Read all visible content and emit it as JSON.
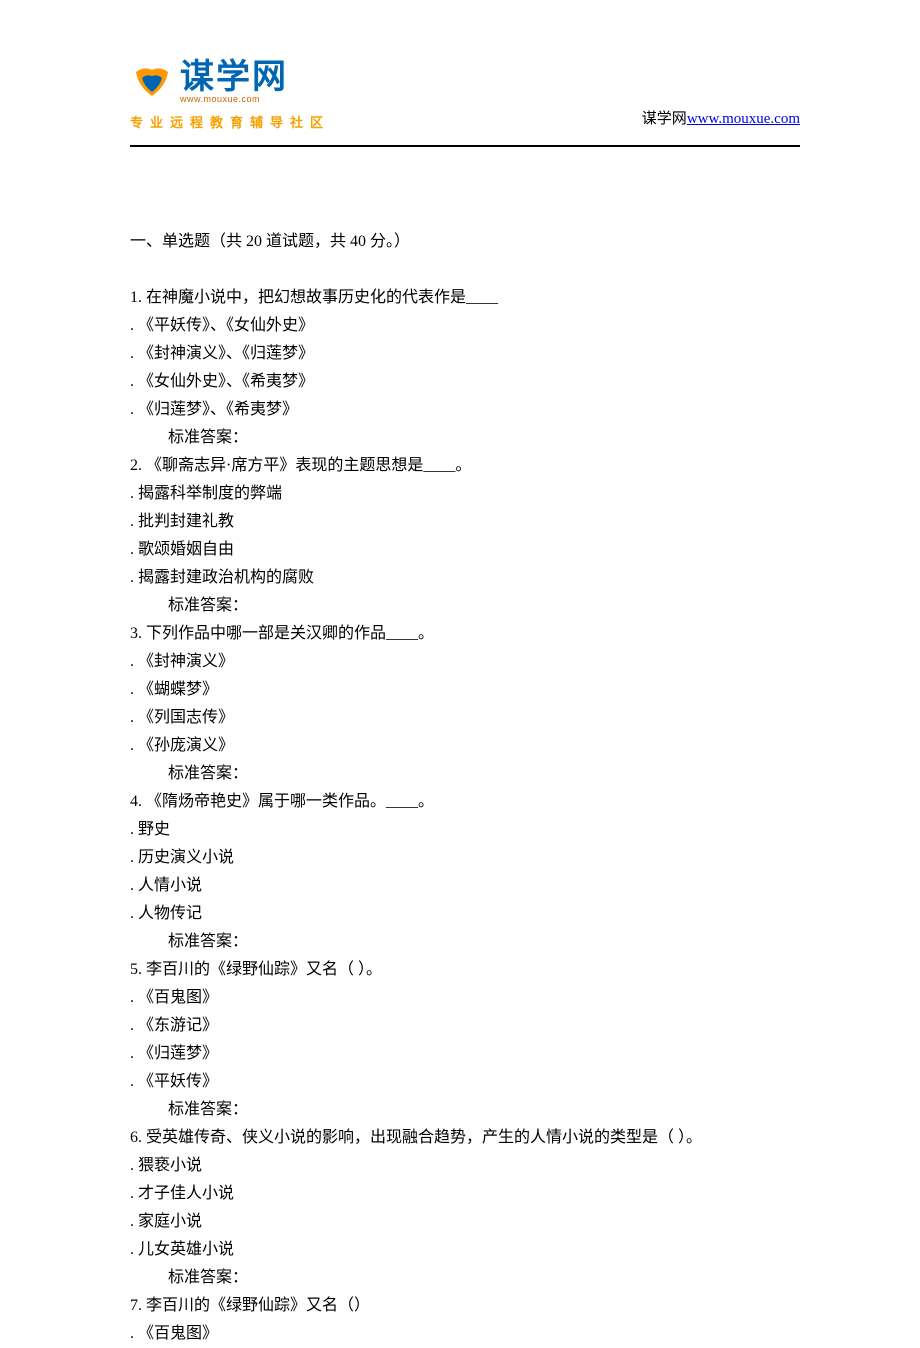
{
  "header": {
    "logo_cn": "谋学网",
    "logo_url": "www.mouxue.com",
    "logo_sub": "专业远程教育辅导社区",
    "right_label": "谋学网",
    "right_link": "www.mouxue.com"
  },
  "section_title": "一、单选题（共 20 道试题，共 40 分。）",
  "questions": [
    {
      "num": "1.",
      "text": "  在神魔小说中，把幻想故事历史化的代表作是____",
      "options": [
        ".  《平妖传》、《女仙外史》",
        ".  《封神演义》、《归莲梦》",
        ".  《女仙外史》、《希夷梦》",
        ".  《归莲梦》、《希夷梦》"
      ],
      "answer": "标准答案："
    },
    {
      "num": "2.",
      "text": "  《聊斋志异·席方平》表现的主题思想是____。",
      "options": [
        ".  揭露科举制度的弊端",
        ".  批判封建礼教",
        ".  歌颂婚姻自由",
        ".  揭露封建政治机构的腐败"
      ],
      "answer": "标准答案："
    },
    {
      "num": "3.",
      "text": "  下列作品中哪一部是关汉卿的作品____。",
      "options": [
        ".  《封神演义》",
        ".  《蝴蝶梦》",
        ".  《列国志传》",
        ".  《孙庞演义》"
      ],
      "answer": "标准答案："
    },
    {
      "num": "4.",
      "text": "  《隋炀帝艳史》属于哪一类作品。____。",
      "options": [
        ".  野史",
        ".  历史演义小说",
        ".  人情小说",
        ".  人物传记"
      ],
      "answer": "标准答案："
    },
    {
      "num": "5.",
      "text": "  李百川的《绿野仙踪》又名（   ）。",
      "options": [
        ".  《百鬼图》",
        ".  《东游记》",
        ".  《归莲梦》",
        ".  《平妖传》"
      ],
      "answer": "标准答案："
    },
    {
      "num": "6.",
      "text": "  受英雄传奇、侠义小说的影响，出现融合趋势，产生的人情小说的类型是（   ）。",
      "options": [
        ".  猥亵小说",
        ".  才子佳人小说",
        ".  家庭小说",
        ".  儿女英雄小说"
      ],
      "answer": "标准答案："
    },
    {
      "num": "7.",
      "text": "  李百川的《绿野仙踪》又名（）",
      "options": [
        ".  《百鬼图》"
      ],
      "answer": null
    }
  ]
}
